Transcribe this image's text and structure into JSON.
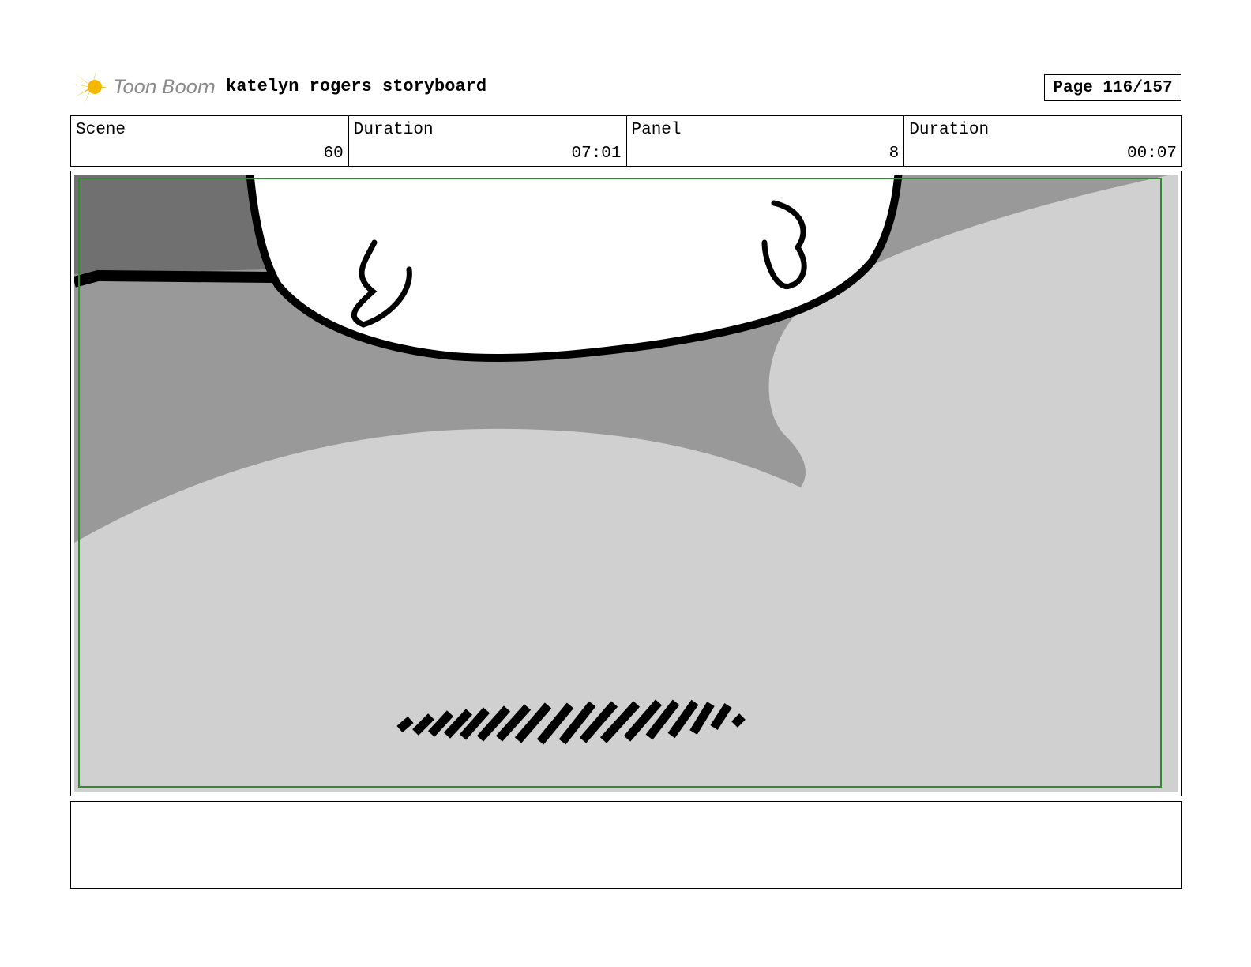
{
  "header": {
    "logo_text": "Toon Boom",
    "title": "katelyn rogers storyboard",
    "page_label": "Page 116/157"
  },
  "info": {
    "scene_label": "Scene",
    "scene_value": "60",
    "scene_duration_label": "Duration",
    "scene_duration_value": "07:01",
    "panel_label": "Panel",
    "panel_value": "8",
    "panel_duration_label": "Duration",
    "panel_duration_value": "00:07"
  },
  "colors": {
    "logo_accent": "#f5b800",
    "safe_frame": "#2e8b2e",
    "dark_gray": "#707070",
    "mid_gray": "#999999",
    "light_gray": "#d0d0d0"
  },
  "notes": {
    "text": ""
  }
}
